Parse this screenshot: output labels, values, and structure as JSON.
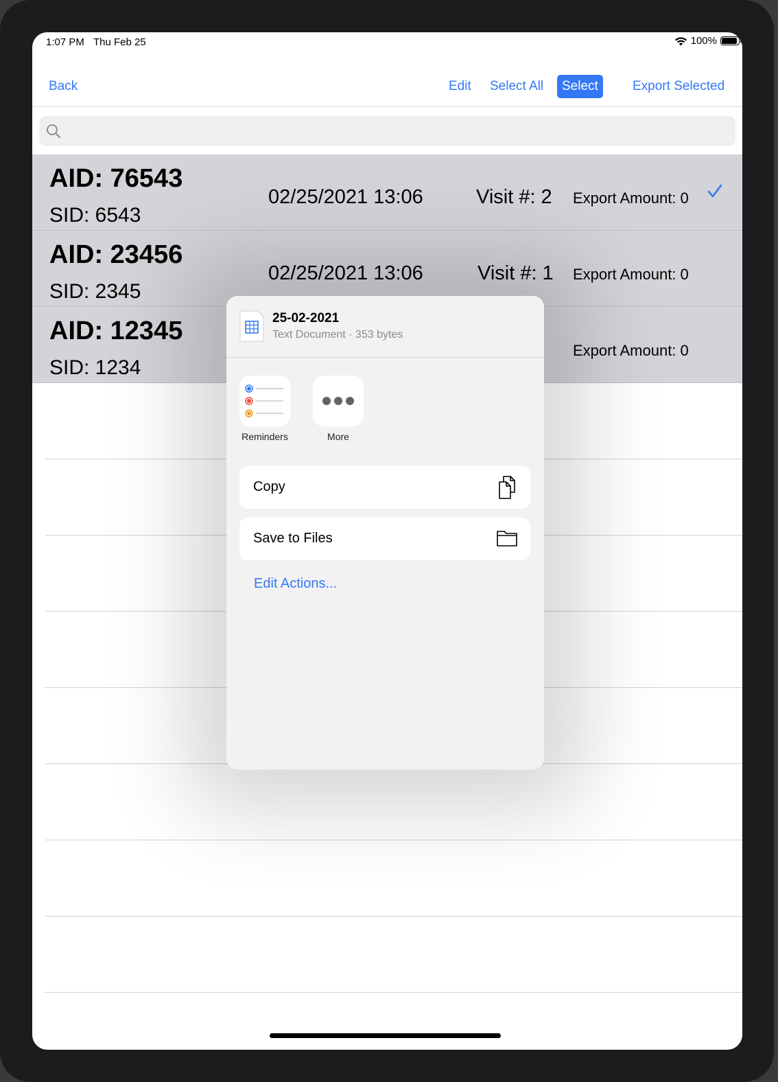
{
  "status": {
    "time": "1:07 PM",
    "date": "Thu Feb 25",
    "battery": "100%",
    "battery_level": 1.0
  },
  "nav": {
    "back": "Back",
    "edit": "Edit",
    "select_all": "Select All",
    "select": "Select",
    "export_selected": "Export Selected"
  },
  "search": {
    "placeholder": ""
  },
  "rows": [
    {
      "aid": "AID: 76543",
      "sid": "SID: 6543",
      "date": "02/25/2021 13:06",
      "visit": "Visit #: 2",
      "export": "Export Amount: 0",
      "selected": true
    },
    {
      "aid": "AID: 23456",
      "sid": "SID: 2345",
      "date": "02/25/2021 13:06",
      "visit": "Visit #: 1",
      "export": "Export Amount: 0",
      "selected": false
    },
    {
      "aid": "AID: 12345",
      "sid": "SID: 1234",
      "date": "",
      "visit": "",
      "export": "Export Amount: 0",
      "selected": false
    }
  ],
  "share_sheet": {
    "file_name": "25-02-2021",
    "file_info": "Text Document · 353 bytes",
    "apps": [
      {
        "label": "Reminders",
        "icon": "reminders-icon"
      },
      {
        "label": "More",
        "icon": "more-icon"
      }
    ],
    "actions": [
      {
        "label": "Copy",
        "icon": "copy-icon"
      },
      {
        "label": "Save to Files",
        "icon": "folder-icon"
      }
    ],
    "edit_actions": "Edit Actions..."
  },
  "colors": {
    "accent": "#3478f6",
    "row_selected_bg": "#d3d3d8"
  }
}
